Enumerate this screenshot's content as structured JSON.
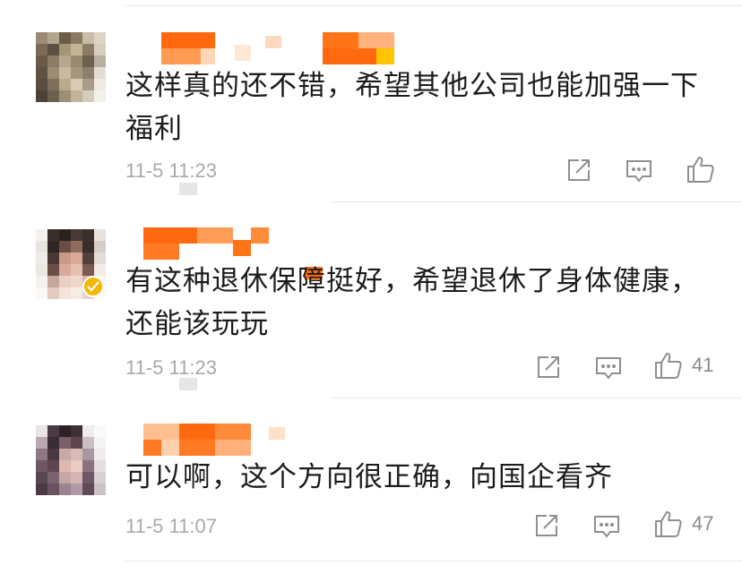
{
  "colors": {
    "text": "#1c1c1c",
    "meta": "#a9a9a9",
    "icon": "#8f8f8f",
    "divider": "#e9e9e9",
    "redacted_name": "#ff7a1a",
    "verified_badge": "#f5b800"
  },
  "comments": [
    {
      "text_line1": "这样真的还不错，希望其他公司也能加强一下",
      "text_line2": "福利",
      "time": "11-5 11:23",
      "like_count": "",
      "verified": false,
      "icons": {
        "share": "share-icon",
        "reply": "comment-icon",
        "like": "thumbs-up-icon"
      }
    },
    {
      "text_line1": "有这种退休保障挺好，希望退休了身体健康，",
      "text_line2": "还能该玩玩",
      "time": "11-5 11:23",
      "like_count": "41",
      "verified": true,
      "icons": {
        "share": "share-icon",
        "reply": "comment-icon",
        "like": "thumbs-up-icon"
      }
    },
    {
      "text_line1": "可以啊，这个方向很正确，向国企看齐",
      "text_line2": "",
      "time": "11-5 11:07",
      "like_count": "47",
      "verified": false,
      "icons": {
        "share": "share-icon",
        "reply": "comment-icon",
        "like": "thumbs-up-icon"
      }
    }
  ]
}
